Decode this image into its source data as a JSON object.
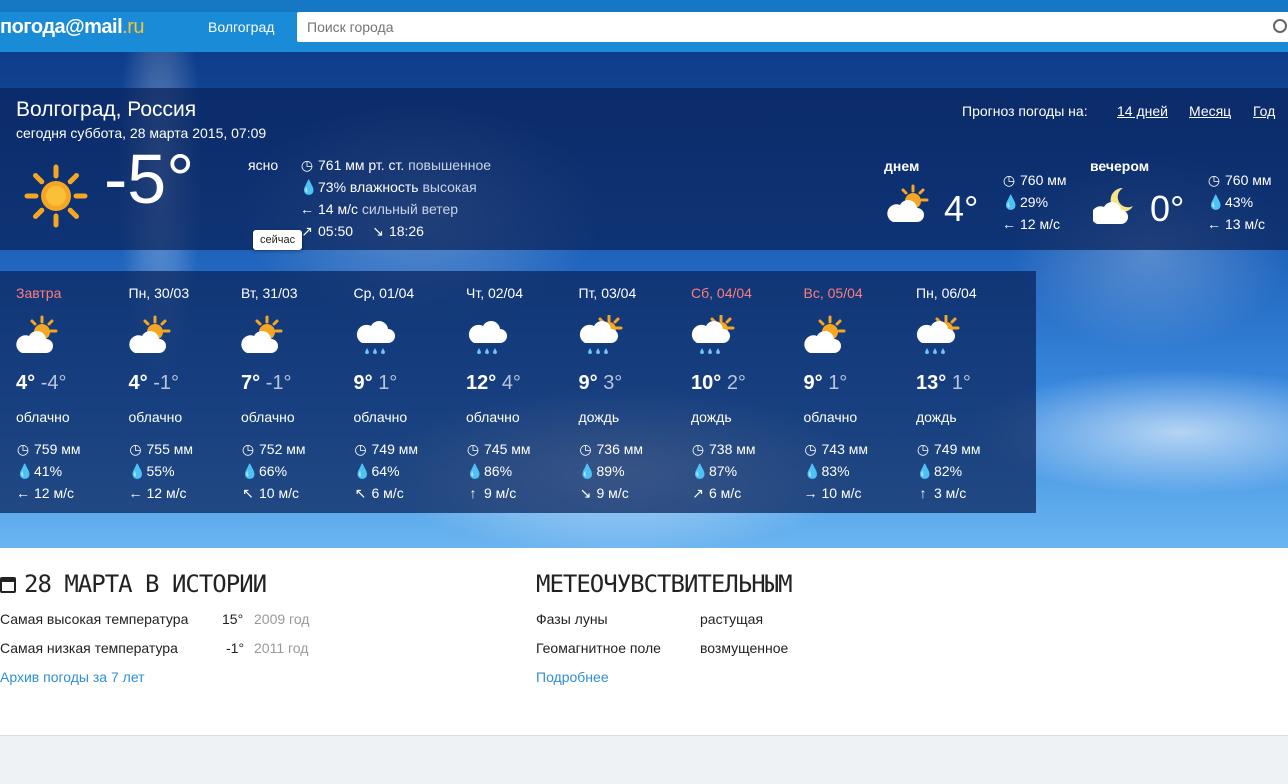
{
  "header": {
    "logo_main": "погода",
    "logo_at": "@mail",
    "logo_ru": ".ru",
    "city_link": "Волгоград",
    "search_placeholder": "Поиск города"
  },
  "now": {
    "city": "Волгоград, Россия",
    "date": "сегодня суббота, 28 марта 2015, 07:09",
    "temp": "-5°",
    "state": "ясно",
    "now_tag": "сейчас",
    "pressure_value": "761 мм рт. ст.",
    "pressure_desc": "повышенное",
    "humidity_value": "73% влажность",
    "humidity_desc": "высокая",
    "wind_value": "14 м/с",
    "wind_desc": "сильный ветер",
    "sunrise": "05:50",
    "sunset": "18:26"
  },
  "forecast_nav": {
    "label": "Прогноз погоды на:",
    "links": [
      "14 дней",
      "Месяц",
      "Год"
    ]
  },
  "parts": [
    {
      "name": "днем",
      "temp": "4°",
      "pressure": "760 мм",
      "humidity": "29%",
      "wind": "12 м/с",
      "icon": "sun-cloud-icon"
    },
    {
      "name": "вечером",
      "temp": "0°",
      "pressure": "760 мм",
      "humidity": "43%",
      "wind": "13 м/с",
      "icon": "moon-cloud-icon"
    }
  ],
  "days": [
    {
      "name": "Завтра",
      "red": true,
      "icon": "sun-cloud-icon",
      "day": "4°",
      "night": "-4°",
      "desc": "облачно",
      "pressure": "759 мм",
      "humidity": "41%",
      "wind_dir": "←",
      "wind": "12 м/с"
    },
    {
      "name": "Пн, 30/03",
      "red": false,
      "icon": "sun-cloud-icon",
      "day": "4°",
      "night": "-1°",
      "desc": "облачно",
      "pressure": "755 мм",
      "humidity": "55%",
      "wind_dir": "←",
      "wind": "12 м/с"
    },
    {
      "name": "Вт, 31/03",
      "red": false,
      "icon": "sun-cloud-icon",
      "day": "7°",
      "night": "-1°",
      "desc": "облачно",
      "pressure": "752 мм",
      "humidity": "66%",
      "wind_dir": "↖",
      "wind": "10 м/с"
    },
    {
      "name": "Ср, 01/04",
      "red": false,
      "icon": "rain-cloud-icon",
      "day": "9°",
      "night": "1°",
      "desc": "облачно",
      "pressure": "749 мм",
      "humidity": "64%",
      "wind_dir": "↖",
      "wind": "6 м/с"
    },
    {
      "name": "Чт, 02/04",
      "red": false,
      "icon": "rain-cloud-icon",
      "day": "12°",
      "night": "4°",
      "desc": "облачно",
      "pressure": "745 мм",
      "humidity": "86%",
      "wind_dir": "↑",
      "wind": "9 м/с"
    },
    {
      "name": "Пт, 03/04",
      "red": false,
      "icon": "sun-rain-icon",
      "day": "9°",
      "night": "3°",
      "desc": "дождь",
      "pressure": "736 мм",
      "humidity": "89%",
      "wind_dir": "↘",
      "wind": "9 м/с"
    },
    {
      "name": "Сб, 04/04",
      "red": true,
      "icon": "sun-rain-icon",
      "day": "10°",
      "night": "2°",
      "desc": "дождь",
      "pressure": "738 мм",
      "humidity": "87%",
      "wind_dir": "↗",
      "wind": "6 м/с"
    },
    {
      "name": "Вс, 05/04",
      "red": true,
      "icon": "sun-cloud-icon",
      "day": "9°",
      "night": "1°",
      "desc": "облачно",
      "pressure": "743 мм",
      "humidity": "83%",
      "wind_dir": "→",
      "wind": "10 м/с"
    },
    {
      "name": "Пн, 06/04",
      "red": false,
      "icon": "sun-rain-icon",
      "day": "13°",
      "night": "1°",
      "desc": "дождь",
      "pressure": "749 мм",
      "humidity": "82%",
      "wind_dir": "↑",
      "wind": "3 м/с"
    }
  ],
  "history": {
    "title": "28 МАРТА В ИСТОРИИ",
    "rows": [
      {
        "label": "Самая высокая температура",
        "temp": "15°",
        "year": "2009 год"
      },
      {
        "label": "Самая низкая температура",
        "temp": "-1°",
        "year": "2011 год"
      }
    ],
    "archive_link": "Архив погоды за 7 лет"
  },
  "meteo": {
    "title": "МЕТЕОЧУВСТВИТЕЛЬНЫМ",
    "rows": [
      {
        "label": "Фазы луны",
        "value": "растущая"
      },
      {
        "label": "Геомагнитное поле",
        "value": "возмущенное"
      }
    ],
    "more_link": "Подробнее"
  },
  "colors": {
    "topbar": "#1a8bd6",
    "panel": "#0a235a",
    "weekend": "#ff7d7d",
    "link": "#2e8fd6",
    "sun": "#f5a623"
  }
}
